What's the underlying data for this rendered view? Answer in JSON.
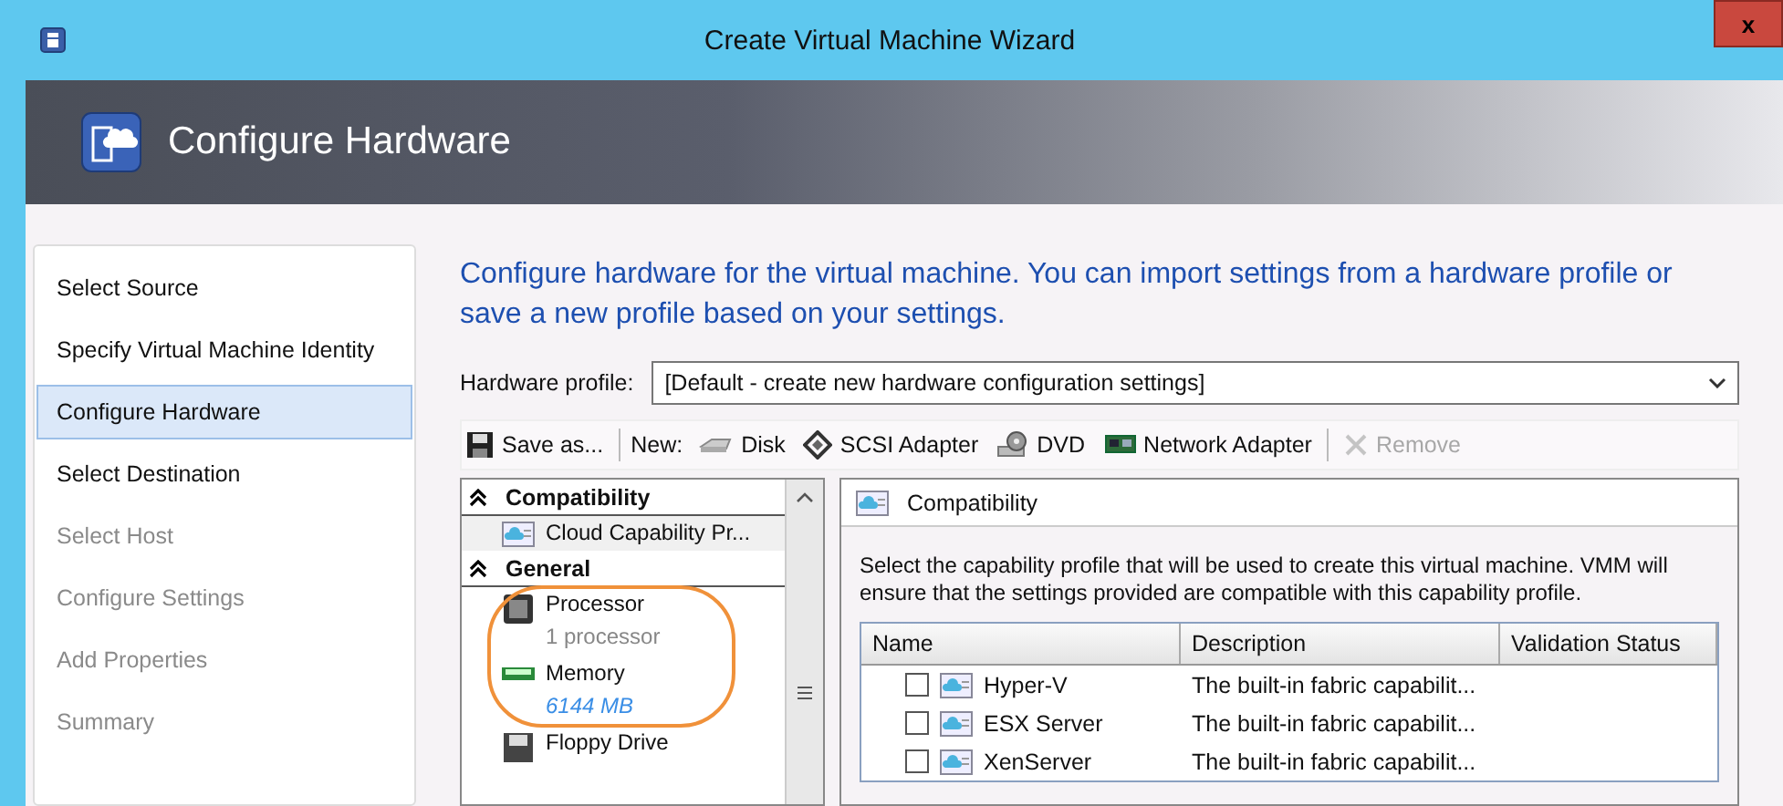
{
  "window": {
    "title": "Create Virtual Machine Wizard",
    "close": "x"
  },
  "header": {
    "title": "Configure Hardware"
  },
  "nav": [
    {
      "label": "Select Source",
      "selected": false,
      "disabled": false
    },
    {
      "label": "Specify Virtual Machine Identity",
      "selected": false,
      "disabled": false
    },
    {
      "label": "Configure Hardware",
      "selected": true,
      "disabled": false
    },
    {
      "label": "Select Destination",
      "selected": false,
      "disabled": false
    },
    {
      "label": "Select Host",
      "selected": false,
      "disabled": true
    },
    {
      "label": "Configure Settings",
      "selected": false,
      "disabled": true
    },
    {
      "label": "Add Properties",
      "selected": false,
      "disabled": true
    },
    {
      "label": "Summary",
      "selected": false,
      "disabled": true
    }
  ],
  "intro": "Configure hardware for the virtual machine. You can import settings from a hardware profile or save a new profile based on your settings.",
  "profile": {
    "label": "Hardware profile:",
    "value": "[Default - create new hardware configuration settings]"
  },
  "toolbar": [
    {
      "kind": "button",
      "label": "Save as...",
      "disabled": false
    },
    {
      "kind": "label",
      "label": "New:"
    },
    {
      "kind": "button",
      "label": "Disk",
      "disabled": false
    },
    {
      "kind": "button",
      "label": "SCSI Adapter",
      "disabled": false
    },
    {
      "kind": "button",
      "label": "DVD",
      "disabled": false
    },
    {
      "kind": "button",
      "label": "Network Adapter",
      "disabled": false
    },
    {
      "kind": "button",
      "label": "Remove",
      "disabled": true
    }
  ],
  "tree": [
    {
      "kind": "group",
      "label": "Compatibility",
      "expanded": true
    },
    {
      "kind": "item",
      "label": "Cloud Capability Pr...",
      "selected": true
    },
    {
      "kind": "group",
      "label": "General",
      "expanded": true
    },
    {
      "kind": "item",
      "label": "Processor",
      "detail": "1 processor",
      "detail_link": false,
      "selected": false
    },
    {
      "kind": "item",
      "label": "Memory",
      "detail": "6144 MB",
      "detail_link": true,
      "selected": false
    },
    {
      "kind": "item",
      "label": "Floppy Drive",
      "selected": false
    }
  ],
  "panel": {
    "title": "Compatibility",
    "text": "Select the capability profile that will be used to create this virtual machine. VMM will ensure that the settings provided are compatible with this capability profile.",
    "columns": [
      "Name",
      "Description",
      "Validation Status"
    ],
    "rows": [
      {
        "name": "Hyper-V",
        "description": "The built-in fabric capabilit...",
        "checked": false
      },
      {
        "name": "ESX Server",
        "description": "The built-in fabric capabilit...",
        "checked": false
      },
      {
        "name": "XenServer",
        "description": "The built-in fabric capabilit...",
        "checked": false
      }
    ]
  }
}
